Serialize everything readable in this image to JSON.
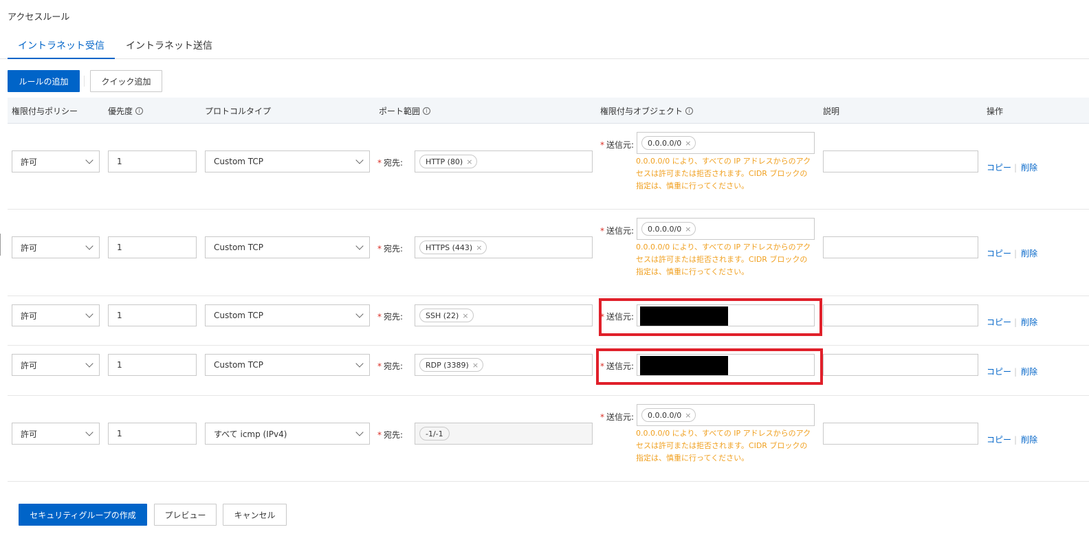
{
  "page": {
    "title": "アクセスルール"
  },
  "tabs": [
    {
      "label": "イントラネット受信",
      "active": true
    },
    {
      "label": "イントラネット送信",
      "active": false
    }
  ],
  "toolbar": {
    "add_label": "ルールの追加",
    "quick_add_label": "クイック追加"
  },
  "table": {
    "headers": {
      "policy": "権限付与ポリシー",
      "priority": "優先度",
      "protocol": "プロトコルタイプ",
      "port_range": "ポート範囲",
      "auth_object": "権限付与オブジェクト",
      "description": "説明",
      "actions": "操作"
    },
    "dest_label": "宛先:",
    "source_label": "送信元:",
    "warning": "0.0.0.0/0 により、すべての IP アドレスからのアクセスは許可または拒否されます。CIDR ブロックの指定は、慎重に行ってください。",
    "copy_label": "コピー",
    "delete_label": "削除",
    "rows": [
      {
        "policy": "許可",
        "priority": "1",
        "protocol": "Custom TCP",
        "port": "HTTP (80)",
        "source": "0.0.0.0/0",
        "description": ""
      },
      {
        "policy": "許可",
        "priority": "1",
        "protocol": "Custom TCP",
        "port": "HTTPS (443)",
        "source": "0.0.0.0/0",
        "description": ""
      },
      {
        "policy": "許可",
        "priority": "1",
        "protocol": "Custom TCP",
        "port": "SSH (22)",
        "source": "",
        "description": ""
      },
      {
        "policy": "許可",
        "priority": "1",
        "protocol": "Custom TCP",
        "port": "RDP (3389)",
        "source": "",
        "description": ""
      },
      {
        "policy": "許可",
        "priority": "1",
        "protocol": "すべて icmp (IPv4)",
        "port": "-1/-1",
        "source": "0.0.0.0/0",
        "description": ""
      }
    ]
  },
  "footer": {
    "create_label": "セキュリティグループの作成",
    "preview_label": "プレビュー",
    "cancel_label": "キャンセル"
  },
  "colors": {
    "primary": "#0064c8",
    "warning": "#f0a020",
    "highlight": "#e0202a",
    "required": "#d93026"
  },
  "icons": {
    "info": "info-circle-icon",
    "chevron": "chevron-down-icon",
    "close": "close-icon"
  }
}
